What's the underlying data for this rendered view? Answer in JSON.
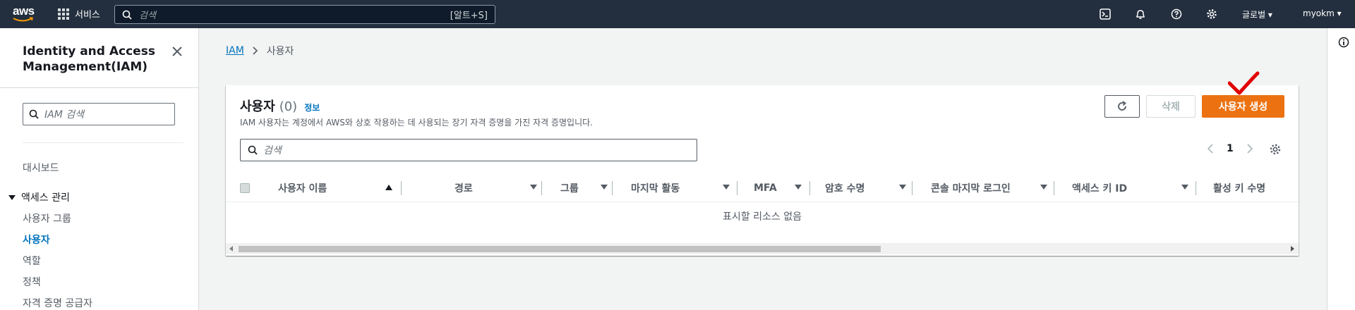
{
  "topnav": {
    "logo_text": "aws",
    "services_label": "서비스",
    "search_placeholder": "검색",
    "search_shortcut": "[알트+S]",
    "region_label": "글로벌 ▾",
    "account_label": "myokm ▾"
  },
  "sidenav": {
    "title": "Identity and Access Management(IAM)",
    "search_placeholder": "IAM 검색",
    "dashboard": "대시보드",
    "section_access": "액세스 관리",
    "items": [
      {
        "label": "사용자 그룹",
        "active": false
      },
      {
        "label": "사용자",
        "active": true
      },
      {
        "label": "역할",
        "active": false
      },
      {
        "label": "정책",
        "active": false
      },
      {
        "label": "자격 증명 공급자",
        "active": false
      }
    ]
  },
  "breadcrumb": {
    "root": "IAM",
    "current": "사용자"
  },
  "panel": {
    "title": "사용자",
    "count": "(0)",
    "info_link": "정보",
    "description": "IAM 사용자는 계정에서 AWS와 상호 작용하는 데 사용되는 장기 자격 증명을 가진 자격 증명입니다.",
    "delete_label": "삭제",
    "create_label": "사용자 생성",
    "search_placeholder": "검색",
    "page_number": "1",
    "columns": [
      "사용자 이름",
      "경로",
      "그룹",
      "마지막 활동",
      "MFA",
      "암호 수명",
      "콘솔 마지막 로그인",
      "액세스 키 ID",
      "활성 키 수명"
    ],
    "empty_message": "표시할 리소스 없음"
  },
  "colors": {
    "nav_bg": "#232f3e",
    "accent_orange": "#ec7211",
    "link_blue": "#0073bb",
    "annotation_red": "#e00000"
  }
}
